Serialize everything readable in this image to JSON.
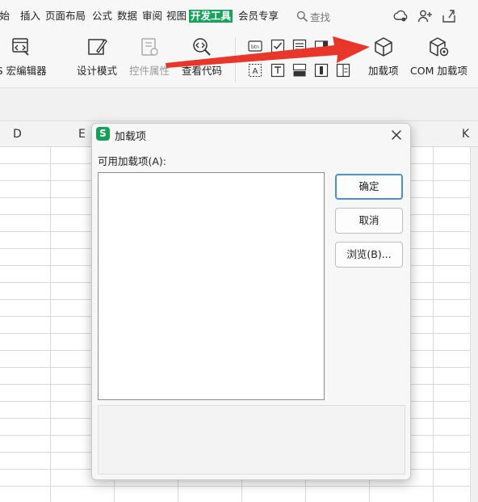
{
  "menu": {
    "items": [
      "开始",
      "插入",
      "页面布局",
      "公式",
      "数据",
      "审阅",
      "视图",
      "开发工具",
      "会员专享"
    ],
    "active": "开发工具",
    "search_label": "查找"
  },
  "ribbon": {
    "buttons": [
      {
        "label": "JS 宏编辑器",
        "icon": "js-macro-editor-icon"
      },
      {
        "label": "设计模式",
        "icon": "design-mode-icon"
      },
      {
        "label": "控件属性",
        "icon": "control-properties-icon",
        "disabled": true
      },
      {
        "label": "查看代码",
        "icon": "view-code-icon"
      },
      {
        "label": "加载项",
        "icon": "addin-cube-icon"
      },
      {
        "label": "COM 加载项",
        "icon": "com-addin-gear-icon"
      }
    ],
    "controls_row1": [
      "button-control-icon",
      "checkbox-control-icon",
      "list-control-icon",
      "combo-control-icon",
      "radio-control-icon"
    ],
    "controls_row2": [
      "label-control-icon",
      "textbox-control-icon",
      "toggle-control-icon",
      "scrollbar-control-icon",
      "spin-control-icon"
    ],
    "control_text": {
      "button": "btn",
      "label": "A"
    }
  },
  "grid": {
    "columns": [
      "D",
      "E",
      "K"
    ]
  },
  "dialog": {
    "title": "加载项",
    "logo_letter": "S",
    "available_label": "可用加载项(A):",
    "buttons": {
      "ok": "确定",
      "cancel": "取消",
      "browse": "浏览(B)..."
    }
  },
  "colors": {
    "accent_green": "#17a35c",
    "arrow_red": "#e8362a",
    "focus_blue": "#4a90d9"
  }
}
